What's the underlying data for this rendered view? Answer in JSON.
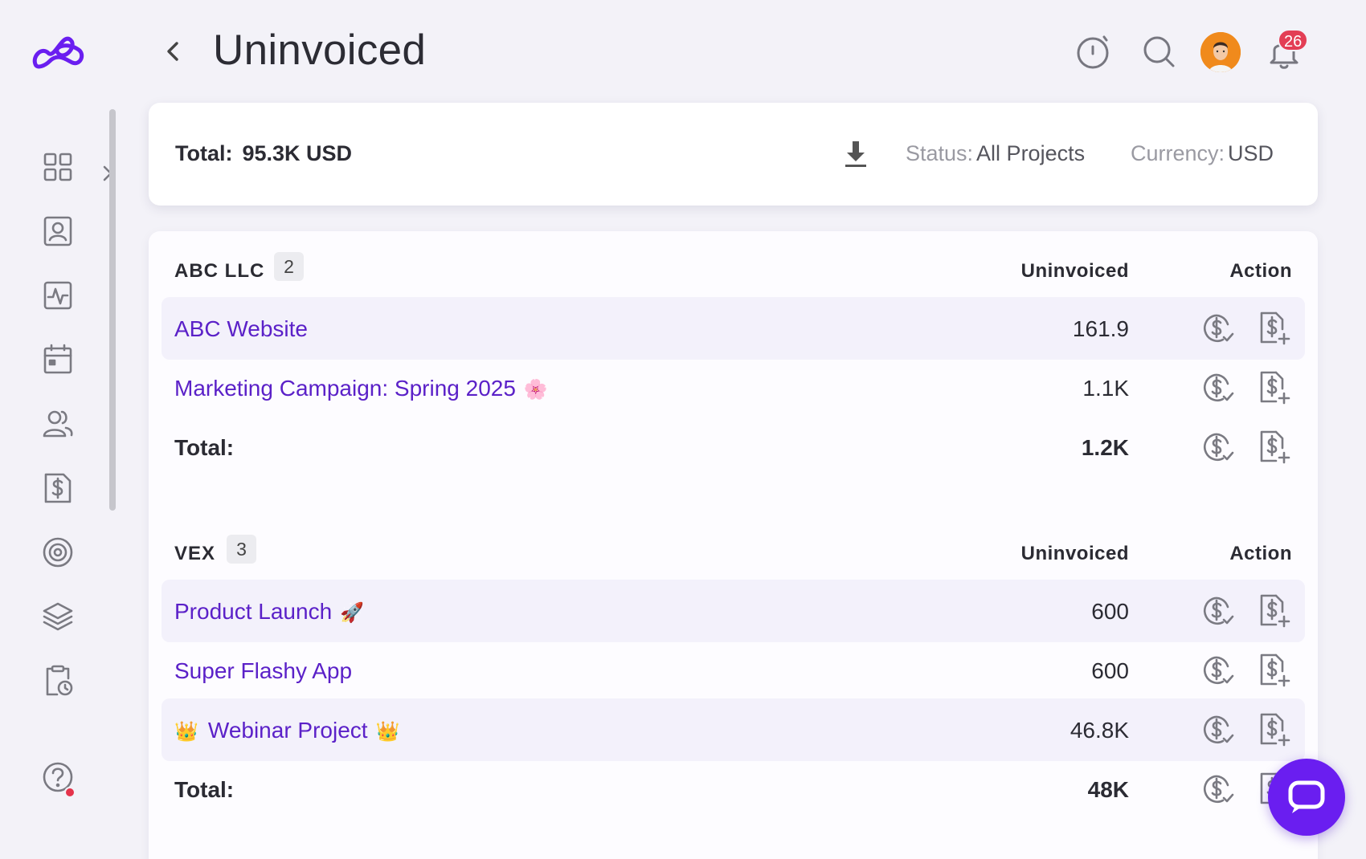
{
  "page": {
    "title": "Uninvoiced"
  },
  "header": {
    "notification_count": "26",
    "avatar_label": "User avatar"
  },
  "sidebar": {
    "items": [
      {
        "icon": "dashboard-grid-icon"
      },
      {
        "icon": "contacts-icon"
      },
      {
        "icon": "activity-icon"
      },
      {
        "icon": "calendar-icon"
      },
      {
        "icon": "team-icon"
      },
      {
        "icon": "invoice-dollar-icon"
      },
      {
        "icon": "target-icon"
      },
      {
        "icon": "layers-icon"
      },
      {
        "icon": "timesheet-icon"
      },
      {
        "icon": "help-icon"
      }
    ]
  },
  "summary": {
    "total_label": "Total:",
    "total_value": "95.3K USD",
    "status_label": "Status:",
    "status_value": "All Projects",
    "currency_label": "Currency:",
    "currency_value": "USD"
  },
  "columns": {
    "uninvoiced": "Uninvoiced",
    "action": "Action"
  },
  "groups": [
    {
      "client": "ABC LLC",
      "count": "2",
      "projects": [
        {
          "name": "ABC Website",
          "emoji": "",
          "amount": "161.9"
        },
        {
          "name": "Marketing Campaign: Spring 2025",
          "emoji": "🌸",
          "amount": "1.1K"
        }
      ],
      "total_label": "Total:",
      "total_amount": "1.2K"
    },
    {
      "client": "VEX",
      "count": "3",
      "projects": [
        {
          "name": "Product Launch",
          "emoji": "🚀",
          "amount": "600"
        },
        {
          "name": "Super Flashy App",
          "emoji": "",
          "amount": "600"
        },
        {
          "name": "Webinar Project",
          "emoji_pre": "👑",
          "emoji": "👑",
          "amount": "46.8K"
        }
      ],
      "total_label": "Total:",
      "total_amount": "48K"
    }
  ],
  "colors": {
    "accent": "#5b21c8",
    "fab": "#6a1ef0",
    "badge": "#e33e55"
  }
}
